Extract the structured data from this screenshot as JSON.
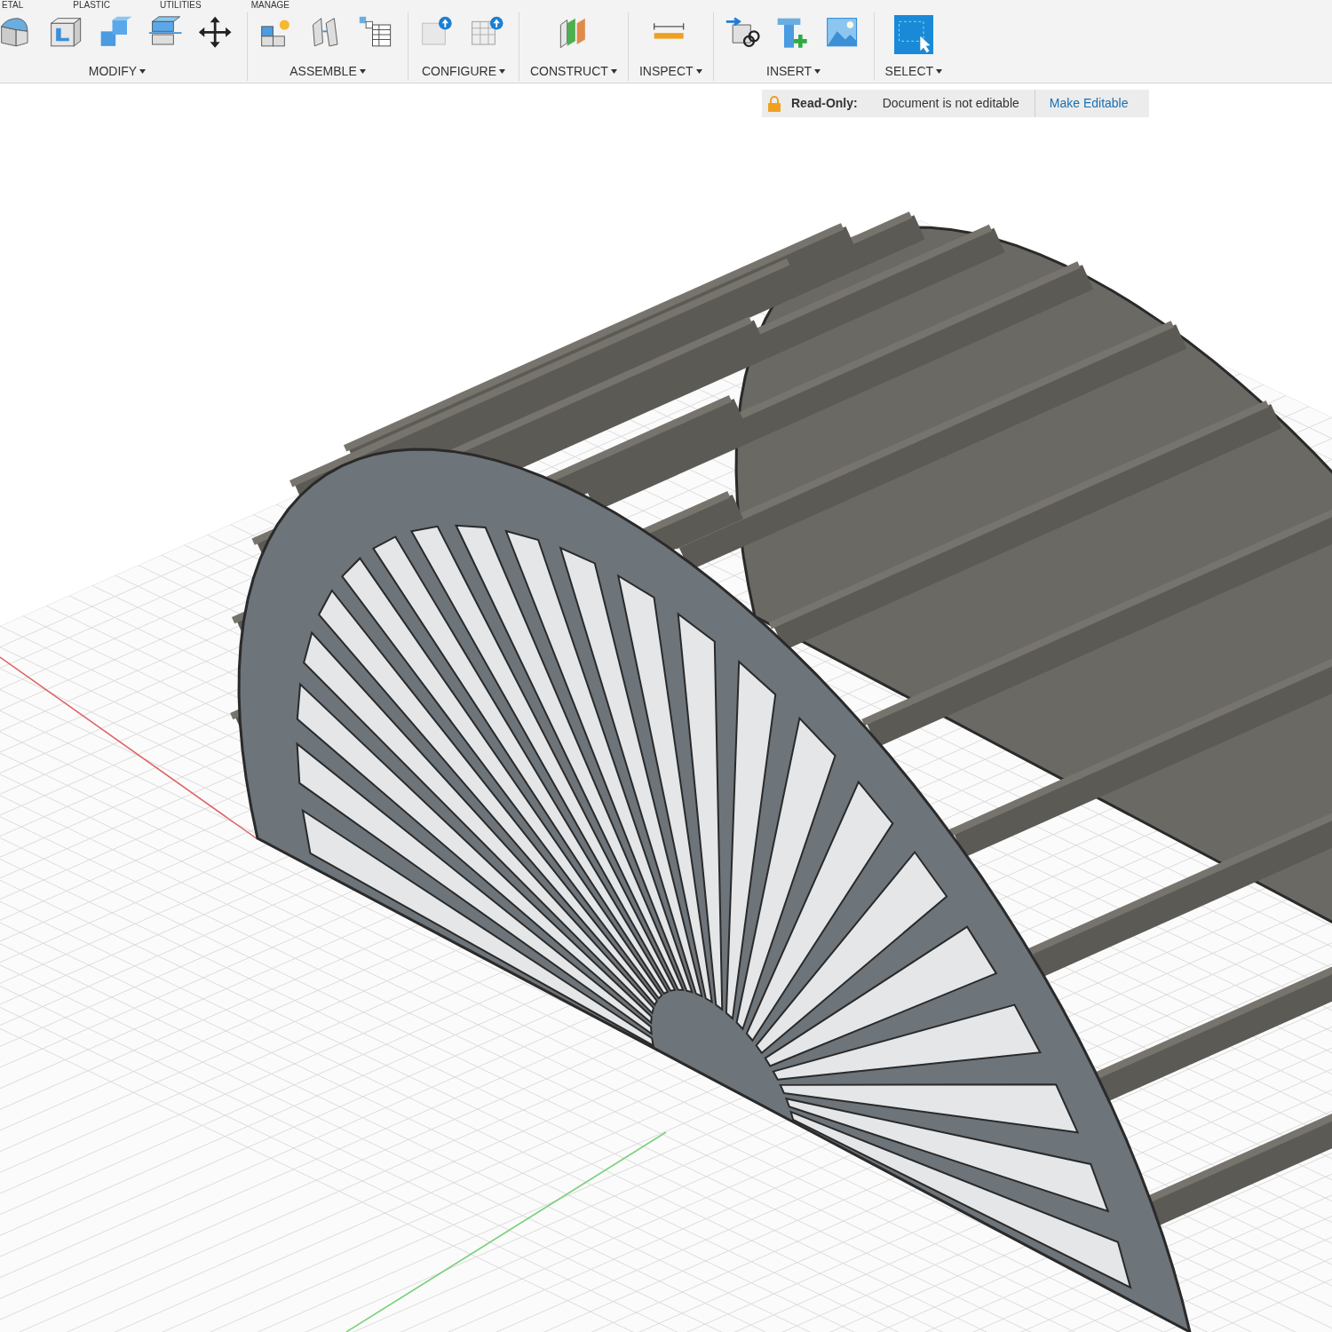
{
  "ribbon_tabs": [
    {
      "label": "ETAL"
    },
    {
      "label": "PLASTIC"
    },
    {
      "label": "UTILITIES"
    },
    {
      "label": "MANAGE"
    }
  ],
  "toolbar_groups": [
    {
      "label": "MODIFY",
      "tools": [
        {
          "kind": "rounded"
        },
        {
          "kind": "hollow"
        },
        {
          "kind": "cubes"
        },
        {
          "kind": "slab"
        },
        {
          "kind": "move"
        }
      ]
    },
    {
      "label": "ASSEMBLE",
      "tools": [
        {
          "kind": "star-cube"
        },
        {
          "kind": "joint"
        },
        {
          "kind": "table"
        }
      ]
    },
    {
      "label": "CONFIGURE",
      "tools": [
        {
          "kind": "config-box"
        },
        {
          "kind": "config-grid"
        }
      ]
    },
    {
      "label": "CONSTRUCT",
      "tools": [
        {
          "kind": "plane"
        }
      ]
    },
    {
      "label": "INSPECT",
      "tools": [
        {
          "kind": "measure"
        }
      ]
    },
    {
      "label": "INSERT",
      "tools": [
        {
          "kind": "link-box"
        },
        {
          "kind": "bolt"
        },
        {
          "kind": "image"
        }
      ]
    },
    {
      "label": "SELECT",
      "tools": [
        {
          "kind": "select"
        }
      ]
    }
  ],
  "readonly_banner": {
    "title": "Read-Only:",
    "message": "Document is not editable",
    "action": "Make Editable"
  }
}
